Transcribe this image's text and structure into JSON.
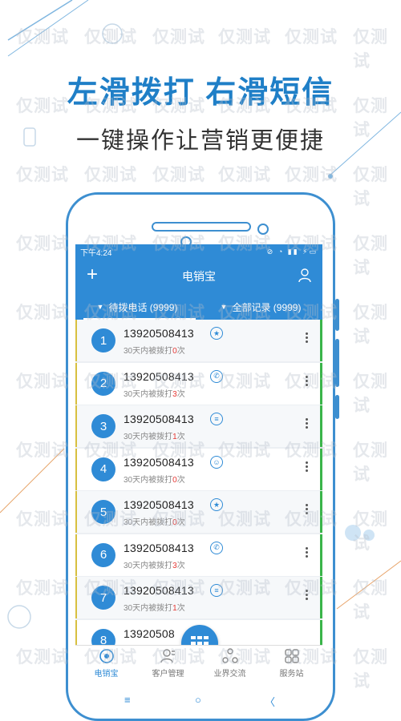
{
  "promo": {
    "headline": "左滑拨打 右滑短信",
    "subheadline": "一键操作让营销更便捷"
  },
  "status_bar": {
    "time": "下午4:24"
  },
  "app": {
    "title": "电销宝"
  },
  "tabs": [
    {
      "label": "待拨电话 (9999)",
      "active": true
    },
    {
      "label": "全部记录 (9999)",
      "active": false
    }
  ],
  "calls": [
    {
      "index": "1",
      "number": "13920508413",
      "prefix": "30天内被拨打",
      "count": "0",
      "suffix": "次",
      "icon": "star-icon",
      "glyph": "★"
    },
    {
      "index": "2",
      "number": "13920508413",
      "prefix": "30天内被拨打",
      "count": "3",
      "suffix": "次",
      "icon": "phone-icon",
      "glyph": "✆"
    },
    {
      "index": "3",
      "number": "13920508413",
      "prefix": "30天内被拨打",
      "count": "1",
      "suffix": "次",
      "icon": "list-icon",
      "glyph": "≡"
    },
    {
      "index": "4",
      "number": "13920508413",
      "prefix": "30天内被拨打",
      "count": "0",
      "suffix": "次",
      "icon": "smile-icon",
      "glyph": "☺"
    },
    {
      "index": "5",
      "number": "13920508413",
      "prefix": "30天内被拨打",
      "count": "0",
      "suffix": "次",
      "icon": "star-icon",
      "glyph": "★"
    },
    {
      "index": "6",
      "number": "13920508413",
      "prefix": "30天内被拨打",
      "count": "3",
      "suffix": "次",
      "icon": "phone-icon",
      "glyph": "✆"
    },
    {
      "index": "7",
      "number": "13920508413",
      "prefix": "30天内被拨打",
      "count": "1",
      "suffix": "次",
      "icon": "list-icon",
      "glyph": "≡"
    },
    {
      "index": "8",
      "number": "13920508",
      "prefix": "",
      "count": "",
      "suffix": "",
      "icon": "",
      "glyph": ""
    }
  ],
  "bottom_nav": [
    {
      "label": "电销宝",
      "icon": "home-icon",
      "active": true
    },
    {
      "label": "客户管理",
      "icon": "customer-icon",
      "active": false
    },
    {
      "label": "业界交流",
      "icon": "community-icon",
      "active": false
    },
    {
      "label": "服务站",
      "icon": "service-icon",
      "active": false
    }
  ],
  "soft_keys": {
    "menu": "≡",
    "home": "○",
    "back": "〈"
  },
  "watermark": "仅测试",
  "colors": {
    "primary": "#2f8bd6",
    "headline": "#1f7fc7",
    "alert": "#e53935"
  }
}
